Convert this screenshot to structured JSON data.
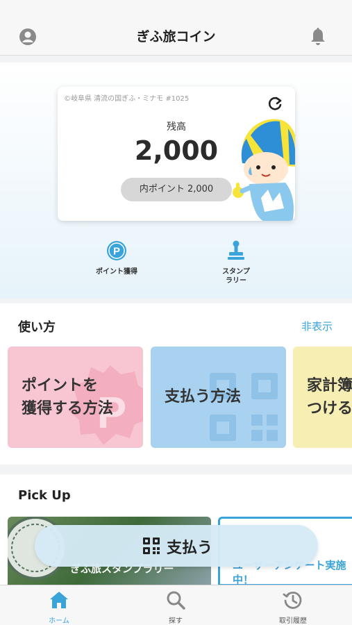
{
  "header": {
    "title": "ぎふ旅コイン"
  },
  "card": {
    "location": "©岐阜県 清流の国ぎふ・ミナモ #1025",
    "balance_label": "残高",
    "balance_value": "2,000",
    "points_pill": "内ポイント 2,000"
  },
  "quick_actions": [
    {
      "label": "ポイント獲得",
      "icon": "point-icon"
    },
    {
      "label_line1": "スタンプ",
      "label_line2": "ラリー",
      "icon": "stamp-icon"
    }
  ],
  "howto": {
    "title": "使い方",
    "hide_label": "非表示",
    "tiles": [
      {
        "line1": "ポイントを",
        "line2": "獲得する方法"
      },
      {
        "line1": "支払う方法"
      },
      {
        "line1": "家計簿",
        "line2": "つける"
      }
    ]
  },
  "pickup": {
    "title": "Pick Up",
    "banner1_text": "ぎふ旅スタンプラリー",
    "banner2_text": "ユーザーアンケート実施中！"
  },
  "pay_button": {
    "label": "支払う"
  },
  "tabs": [
    {
      "label": "ホーム",
      "icon": "home-icon",
      "active": true
    },
    {
      "label": "探す",
      "icon": "search-icon",
      "active": false
    },
    {
      "label": "取引履歴",
      "icon": "history-icon",
      "active": false
    }
  ],
  "colors": {
    "accent": "#3aa3d9",
    "pink_tile": "#f8c6d3",
    "blue_tile": "#a8d2ef",
    "yellow_tile": "#f6eeb2"
  }
}
